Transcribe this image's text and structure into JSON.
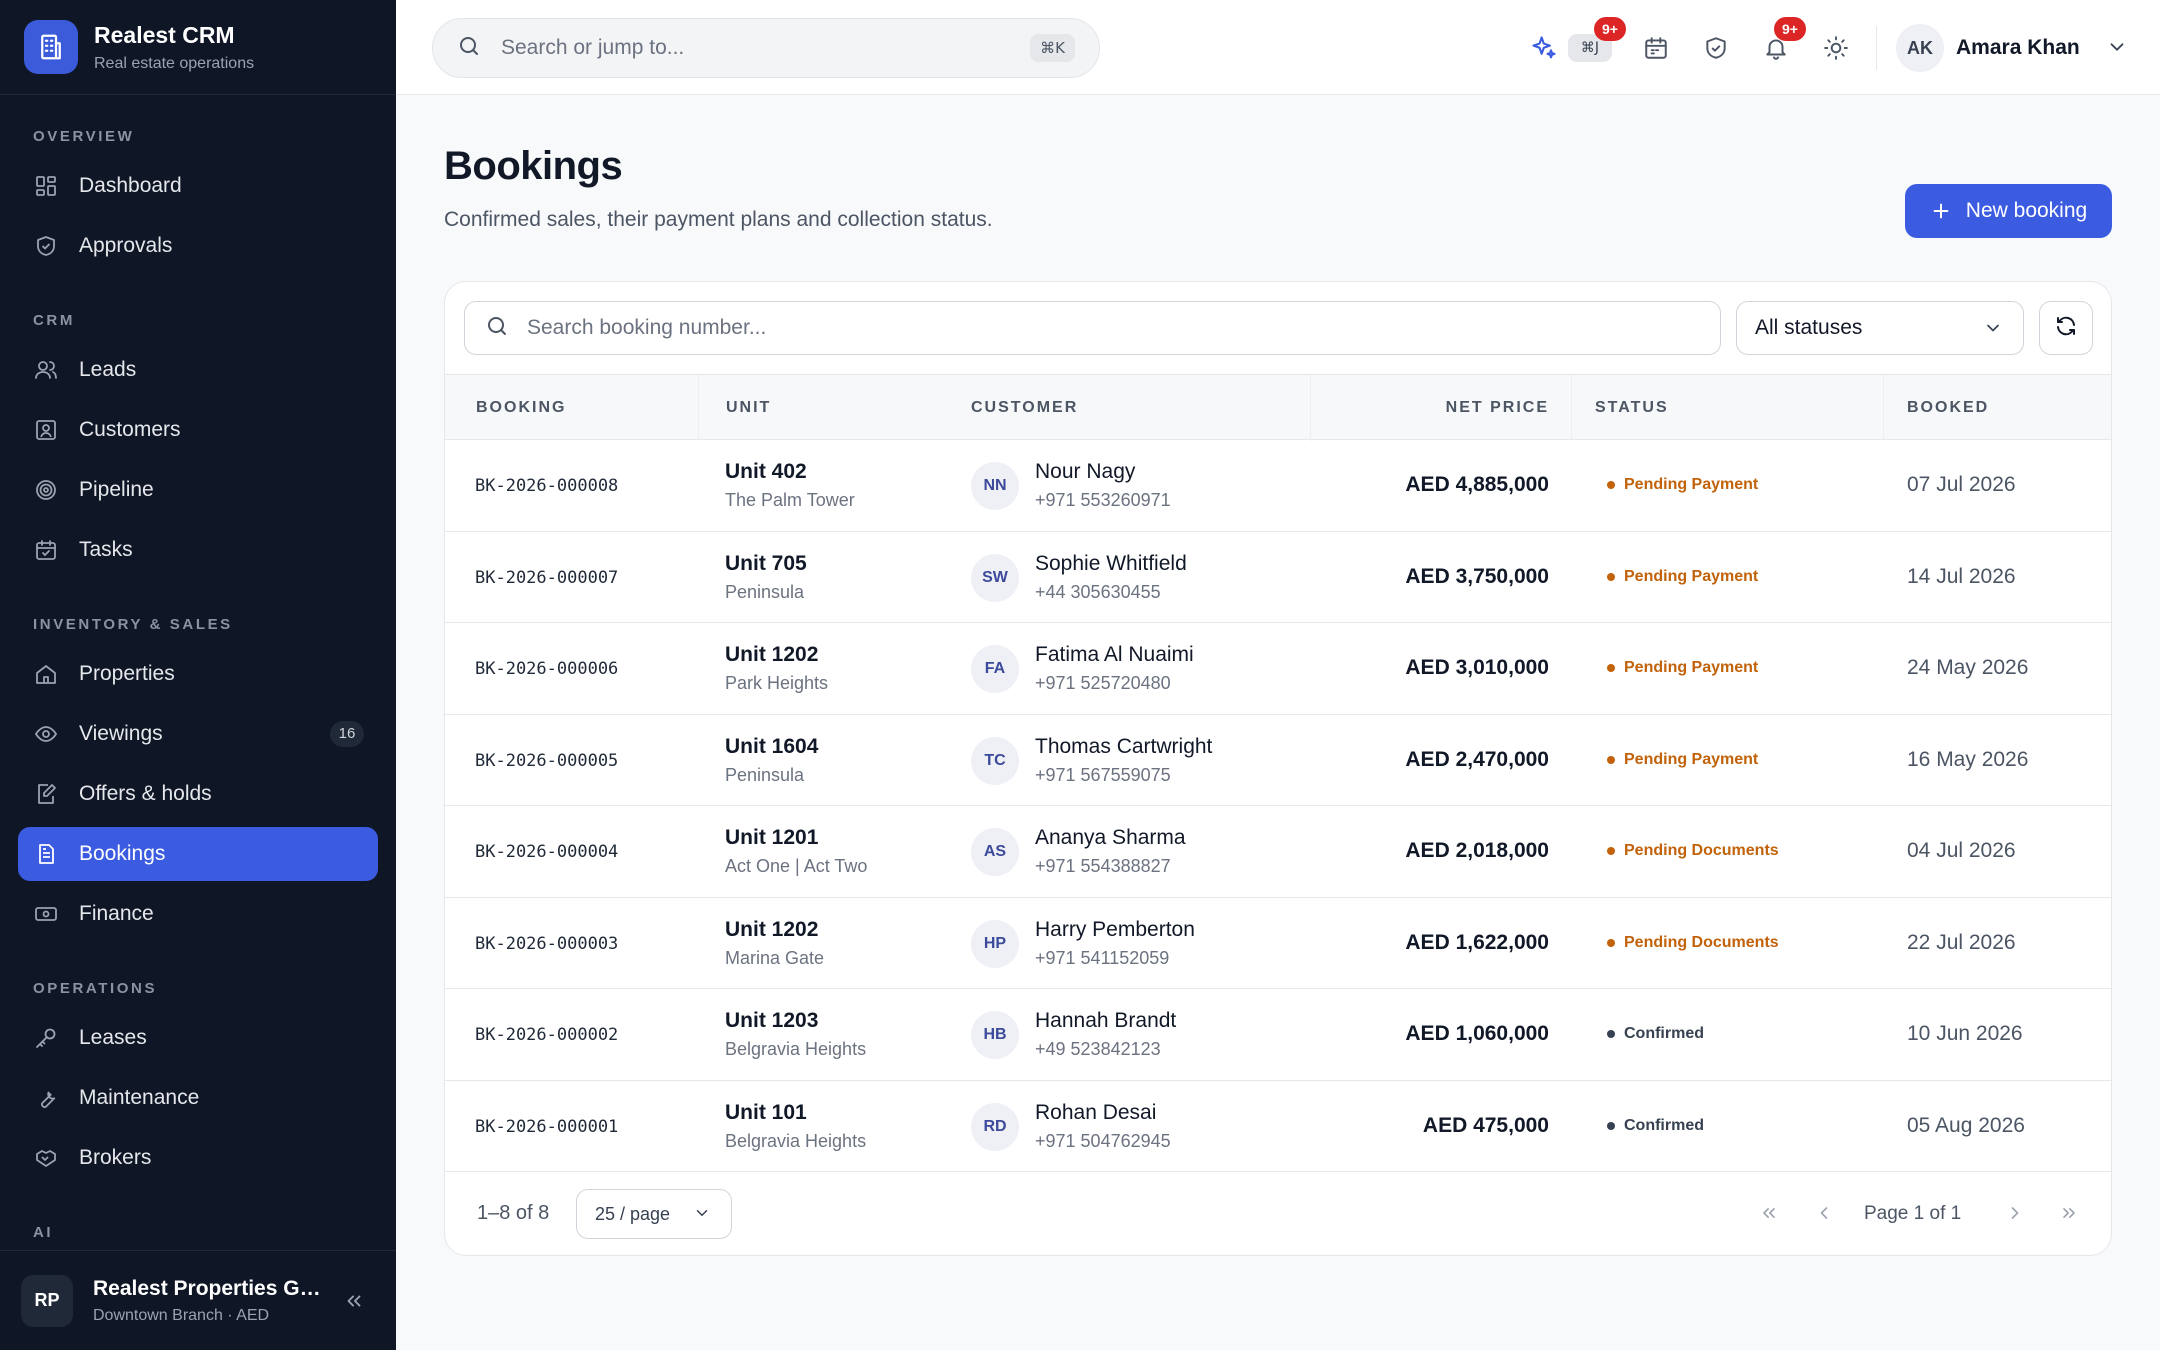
{
  "brand": {
    "title": "Realest CRM",
    "subtitle": "Real estate operations"
  },
  "sidebar": {
    "sections": [
      {
        "label": "OVERVIEW",
        "items": [
          {
            "label": "Dashboard",
            "icon": "dashboard-icon"
          },
          {
            "label": "Approvals",
            "icon": "shield-check-icon"
          }
        ]
      },
      {
        "label": "CRM",
        "items": [
          {
            "label": "Leads",
            "icon": "users-icon"
          },
          {
            "label": "Customers",
            "icon": "contact-card-icon"
          },
          {
            "label": "Pipeline",
            "icon": "target-icon"
          },
          {
            "label": "Tasks",
            "icon": "calendar-check-icon"
          }
        ]
      },
      {
        "label": "INVENTORY & SALES",
        "items": [
          {
            "label": "Properties",
            "icon": "home-icon"
          },
          {
            "label": "Viewings",
            "icon": "eye-icon",
            "badge": "16"
          },
          {
            "label": "Offers & holds",
            "icon": "edit-document-icon"
          },
          {
            "label": "Bookings",
            "icon": "document-icon",
            "active": true
          },
          {
            "label": "Finance",
            "icon": "banknote-icon"
          }
        ]
      },
      {
        "label": "OPERATIONS",
        "items": [
          {
            "label": "Leases",
            "icon": "key-icon"
          },
          {
            "label": "Maintenance",
            "icon": "wrench-icon"
          },
          {
            "label": "Brokers",
            "icon": "handshake-icon"
          }
        ]
      },
      {
        "label": "AI",
        "items": []
      }
    ],
    "org": {
      "initials": "RP",
      "name": "Realest Properties Group",
      "sub": "Downtown Branch · AED"
    }
  },
  "topbar": {
    "search_placeholder": "Search or jump to...",
    "search_shortcut": "⌘K",
    "ai_shortcut": "⌘J",
    "ai_badge": "9+",
    "notif_badge": "9+",
    "user": {
      "initials": "AK",
      "name": "Amara Khan"
    }
  },
  "page": {
    "title": "Bookings",
    "subtitle": "Confirmed sales, their payment plans and collection status.",
    "new_button": "New booking"
  },
  "filters": {
    "search_placeholder": "Search booking number...",
    "status_value": "All statuses"
  },
  "table": {
    "headers": {
      "booking": "BOOKING",
      "unit": "UNIT",
      "customer": "CUSTOMER",
      "net_price": "NET PRICE",
      "status": "STATUS",
      "booked": "BOOKED"
    },
    "rows": [
      {
        "booking": "BK-2026-000008",
        "unit": "Unit 402",
        "project": "The Palm Tower",
        "initials": "NN",
        "customer": "Nour Nagy",
        "phone": "+971 553260971",
        "price": "AED 4,885,000",
        "status": "Pending Payment",
        "status_color": "#c2620a",
        "booked": "07 Jul 2026"
      },
      {
        "booking": "BK-2026-000007",
        "unit": "Unit 705",
        "project": "Peninsula",
        "initials": "SW",
        "customer": "Sophie Whitfield",
        "phone": "+44 305630455",
        "price": "AED 3,750,000",
        "status": "Pending Payment",
        "status_color": "#c2620a",
        "booked": "14 Jul 2026"
      },
      {
        "booking": "BK-2026-000006",
        "unit": "Unit 1202",
        "project": "Park Heights",
        "initials": "FA",
        "customer": "Fatima Al Nuaimi",
        "phone": "+971 525720480",
        "price": "AED 3,010,000",
        "status": "Pending Payment",
        "status_color": "#c2620a",
        "booked": "24 May 2026"
      },
      {
        "booking": "BK-2026-000005",
        "unit": "Unit 1604",
        "project": "Peninsula",
        "initials": "TC",
        "customer": "Thomas Cartwright",
        "phone": "+971 567559075",
        "price": "AED 2,470,000",
        "status": "Pending Payment",
        "status_color": "#c2620a",
        "booked": "16 May 2026"
      },
      {
        "booking": "BK-2026-000004",
        "unit": "Unit 1201",
        "project": "Act One | Act Two",
        "initials": "AS",
        "customer": "Ananya Sharma",
        "phone": "+971 554388827",
        "price": "AED 2,018,000",
        "status": "Pending Documents",
        "status_color": "#c2620a",
        "booked": "04 Jul 2026"
      },
      {
        "booking": "BK-2026-000003",
        "unit": "Unit 1202",
        "project": "Marina Gate",
        "initials": "HP",
        "customer": "Harry Pemberton",
        "phone": "+971 541152059",
        "price": "AED 1,622,000",
        "status": "Pending Documents",
        "status_color": "#c2620a",
        "booked": "22 Jul 2026"
      },
      {
        "booking": "BK-2026-000002",
        "unit": "Unit 1203",
        "project": "Belgravia Heights",
        "initials": "HB",
        "customer": "Hannah Brandt",
        "phone": "+49 523842123",
        "price": "AED 1,060,000",
        "status": "Confirmed",
        "status_color": "#374151",
        "booked": "10 Jun 2026"
      },
      {
        "booking": "BK-2026-000001",
        "unit": "Unit 101",
        "project": "Belgravia Heights",
        "initials": "RD",
        "customer": "Rohan Desai",
        "phone": "+971 504762945",
        "price": "AED 475,000",
        "status": "Confirmed",
        "status_color": "#374151",
        "booked": "05 Aug 2026"
      }
    ]
  },
  "pagination": {
    "range": "1–8 of 8",
    "per_page": "25 / page",
    "page_info": "Page 1 of 1"
  },
  "colors": {
    "accent": "#3b5be0",
    "sidebar_bg": "#0f1626",
    "pending": "#c2620a",
    "badge": "#dc2626"
  }
}
